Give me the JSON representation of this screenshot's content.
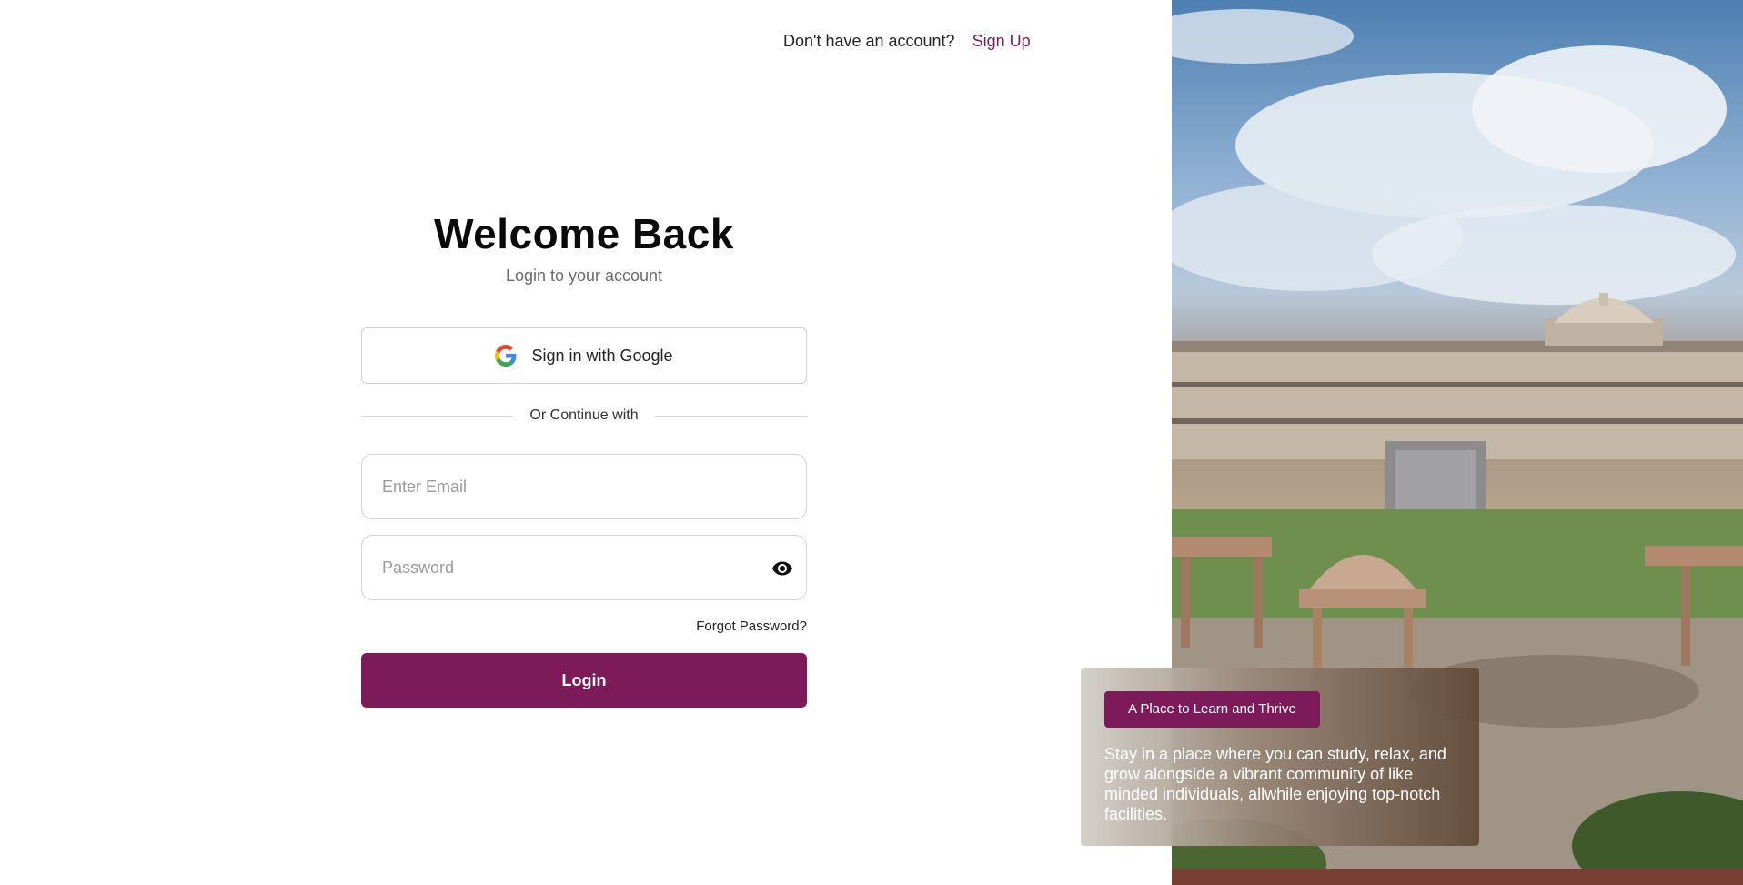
{
  "header": {
    "prompt": "Don't have an account?",
    "signup_label": "Sign Up"
  },
  "login": {
    "title": "Welcome Back",
    "subtitle": "Login to your account",
    "google_label": "Sign in with Google",
    "divider_text": "Or Continue with",
    "email": {
      "value": "",
      "placeholder": "Enter Email"
    },
    "password": {
      "value": "",
      "placeholder": "Password"
    },
    "forgot_label": "Forgot Password?",
    "login_label": "Login"
  },
  "hero": {
    "badge": "A Place to Learn and Thrive",
    "caption": "Stay in a place where you can study, relax, and grow alongside a vibrant community of like minded individuals, allwhile enjoying top-notch facilities."
  },
  "colors": {
    "brand": "#7d1a5a",
    "google_blue": "#4285F4",
    "google_red": "#EA4335",
    "google_yellow": "#FBBC05",
    "google_green": "#34A853"
  },
  "icons": {
    "google": "google-g-icon",
    "eye": "eye-icon"
  }
}
